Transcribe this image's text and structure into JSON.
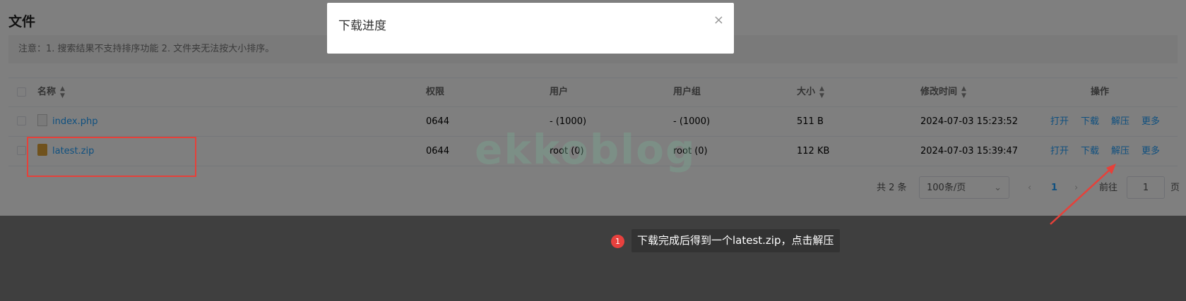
{
  "page": {
    "title": "文件",
    "notice": "注意：1. 搜索结果不支持排序功能 2. 文件夹无法按大小排序。"
  },
  "table": {
    "headers": {
      "name": "名称",
      "perm": "权限",
      "user": "用户",
      "group": "用户组",
      "size": "大小",
      "time": "修改时间",
      "ops": "操作"
    },
    "rows": [
      {
        "name": "index.php",
        "icon": "php-file-icon",
        "perm": "0644",
        "user": "- (1000)",
        "group": "- (1000)",
        "size": "511 B",
        "time": "2024-07-03 15:23:52"
      },
      {
        "name": "latest.zip",
        "icon": "zip-file-icon",
        "perm": "0644",
        "user": "root (0)",
        "group": "root (0)",
        "size": "112 KB",
        "time": "2024-07-03 15:39:47"
      }
    ],
    "ops": {
      "open": "打开",
      "download": "下载",
      "extract": "解压",
      "more": "更多"
    }
  },
  "pagination": {
    "total": "共 2 条",
    "page_size": "100条/页",
    "current": "1",
    "goto_label": "前往",
    "goto_value": "1",
    "unit": "页"
  },
  "dialog": {
    "title": "下载进度",
    "close": "×"
  },
  "watermark": "ekkoblog",
  "tip": {
    "badge": "1",
    "text": "下载完成后得到一个latest.zip，点击解压"
  },
  "colors": {
    "accent": "#20a0ff",
    "highlight": "#e5413a",
    "badge": "#e8413e"
  }
}
